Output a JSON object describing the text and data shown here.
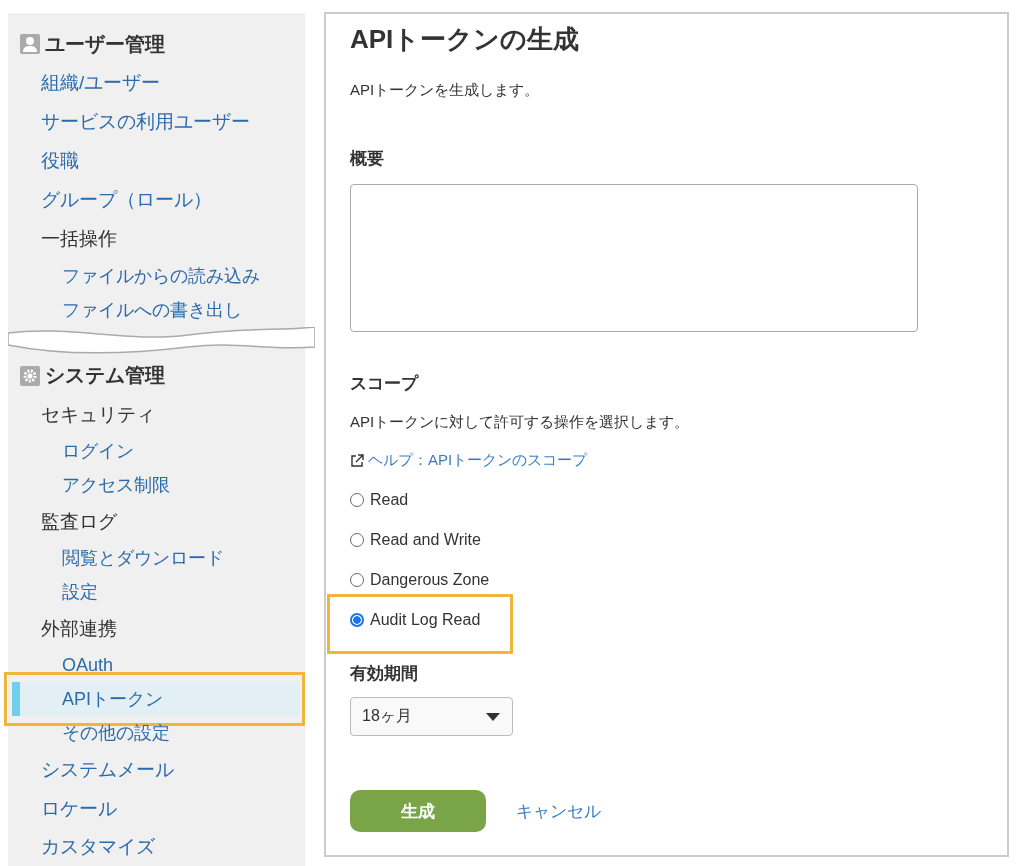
{
  "sidebar": {
    "sections": [
      {
        "title": "ユーザー管理",
        "items": [
          {
            "label": "組織/ユーザー",
            "kind": "link"
          },
          {
            "label": "サービスの利用ユーザー",
            "kind": "link"
          },
          {
            "label": "役職",
            "kind": "link"
          },
          {
            "label": "グループ（ロール）",
            "kind": "link"
          },
          {
            "label": "一括操作",
            "kind": "group",
            "children": [
              {
                "label": "ファイルからの読み込み",
                "selected": false,
                "highlighted": false
              },
              {
                "label": "ファイルへの書き出し",
                "selected": false,
                "highlighted": false
              }
            ]
          }
        ]
      },
      {
        "title": "システム管理",
        "items": [
          {
            "label": "セキュリティ",
            "kind": "group",
            "children": [
              {
                "label": "ログイン",
                "selected": false,
                "highlighted": false
              },
              {
                "label": "アクセス制限",
                "selected": false,
                "highlighted": false
              }
            ]
          },
          {
            "label": "監査ログ",
            "kind": "group",
            "children": [
              {
                "label": "閲覧とダウンロード",
                "selected": false,
                "highlighted": false
              },
              {
                "label": "設定",
                "selected": false,
                "highlighted": false
              }
            ]
          },
          {
            "label": "外部連携",
            "kind": "group",
            "children": [
              {
                "label": "OAuth",
                "selected": false,
                "highlighted": false
              },
              {
                "label": "APIトークン",
                "selected": true,
                "highlighted": true
              },
              {
                "label": "その他の設定",
                "selected": false,
                "highlighted": false
              }
            ]
          },
          {
            "label": "システムメール",
            "kind": "link"
          },
          {
            "label": "ロケール",
            "kind": "link"
          },
          {
            "label": "カスタマイズ",
            "kind": "link"
          }
        ]
      }
    ]
  },
  "main": {
    "title": "APIトークンの生成",
    "description": "APIトークンを生成します。",
    "summary": {
      "label": "概要"
    },
    "scope": {
      "label": "スコープ",
      "description": "APIトークンに対して許可する操作を選択します。",
      "help_link": "ヘルプ：APIトークンのスコープ",
      "options": [
        {
          "label": "Read",
          "selected": false,
          "highlighted": false
        },
        {
          "label": "Read and Write",
          "selected": false,
          "highlighted": false
        },
        {
          "label": "Dangerous Zone",
          "selected": false,
          "highlighted": false
        },
        {
          "label": "Audit Log Read",
          "selected": true,
          "highlighted": true
        }
      ]
    },
    "expiry": {
      "label": "有効期間",
      "value": "18ヶ月"
    },
    "actions": {
      "submit": "生成",
      "cancel": "キャンセル"
    }
  }
}
